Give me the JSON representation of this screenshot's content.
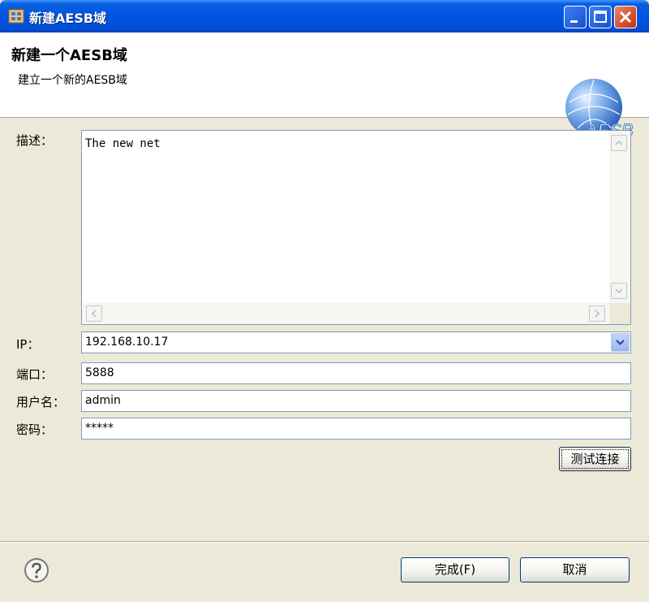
{
  "window": {
    "title": "新建AESB域"
  },
  "header": {
    "title": "新建一个AESB域",
    "subtitle": "建立一个新的AESB域",
    "logo_text": "AESB"
  },
  "form": {
    "description": {
      "label": "描述：",
      "value": "The new net"
    },
    "ip": {
      "label": "IP：",
      "value": "192.168.10.17"
    },
    "port": {
      "label": "端口：",
      "value": "5888"
    },
    "username": {
      "label": "用户名：",
      "value": "admin"
    },
    "password": {
      "label": "密码：",
      "value": "*****"
    },
    "test_button": "测试连接"
  },
  "footer": {
    "finish_label": "完成(F)",
    "cancel_label": "取消"
  },
  "colors": {
    "titlebar": "#0054e3",
    "dialog_bg": "#ece9d8",
    "field_border": "#7f9db9"
  }
}
